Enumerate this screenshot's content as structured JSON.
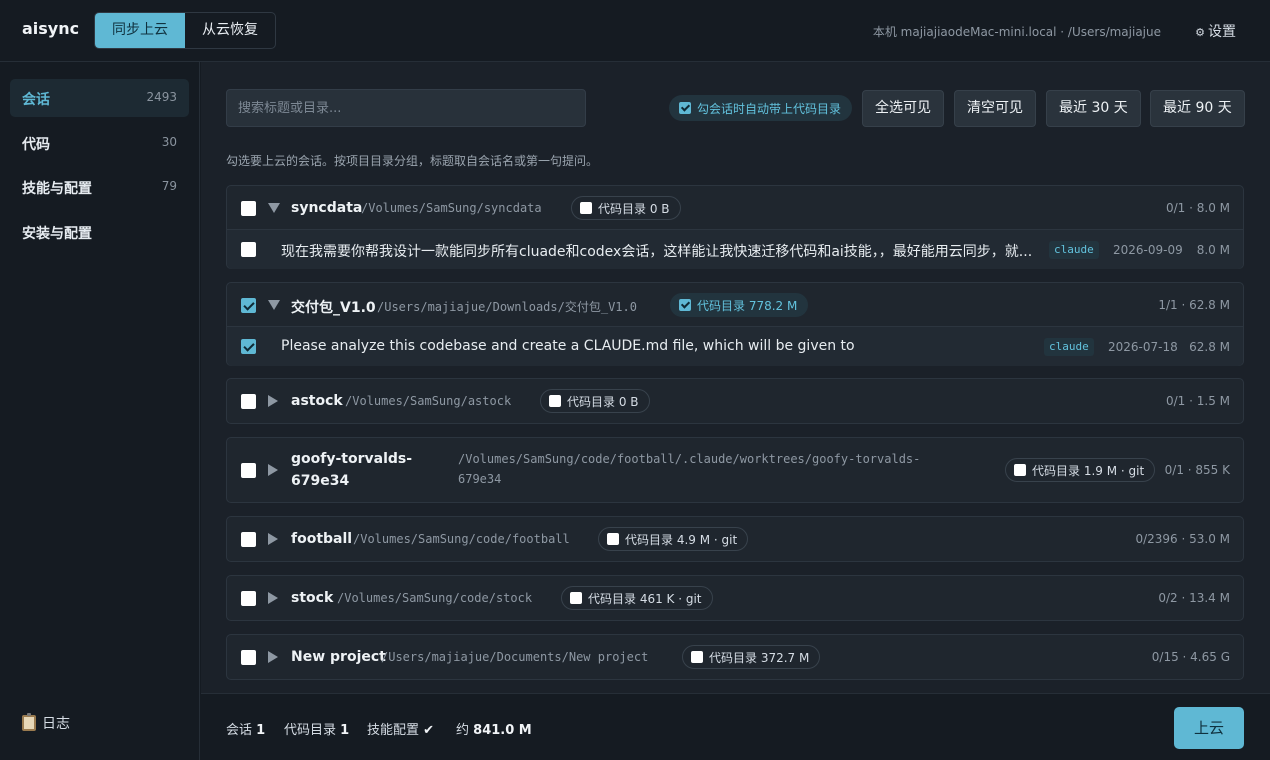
{
  "app": {
    "title": "aisync"
  },
  "header": {
    "modes": [
      {
        "label": "同步上云",
        "active": true
      },
      {
        "label": "从云恢复",
        "active": false
      }
    ],
    "host_info": "本机 majiajiaodeMac-mini.local · /Users/majiajue",
    "settings_label": "设置",
    "settings_icon": "gear-icon"
  },
  "sidebar": {
    "items": [
      {
        "label": "会话",
        "count": "2493",
        "active": true
      },
      {
        "label": "代码",
        "count": "30",
        "active": false
      },
      {
        "label": "技能与配置",
        "count": "79",
        "active": false
      },
      {
        "label": "安装与配置",
        "count": "",
        "active": false
      }
    ],
    "log_label": "日志",
    "log_icon": "clipboard-icon"
  },
  "toolbar": {
    "search_placeholder": "搜索标题或目录...",
    "auto_include_label": "勾会话时自动带上代码目录",
    "auto_include_checked": true,
    "select_visible": "全选可见",
    "clear_visible": "清空可见",
    "last_30": "最近 30 天",
    "last_90": "最近 90 天"
  },
  "hint": "勾选要上云的会话。按项目目录分组，标题取自会话名或第一句提问。",
  "groups": [
    {
      "name": "syncdata",
      "path": "/Volumes/SamSung/syncdata",
      "checked": false,
      "expanded": true,
      "code_label": "代码目录 0 B",
      "code_checked": false,
      "stat": "0/1 · 8.0 M",
      "sessions": [
        {
          "title": "现在我需要你帮我设计一款能同步所有cluade和codex会话，这样能让我快速迁移代码和ai技能，，最好能用云同步，就...",
          "tag": "claude",
          "date": "2026-09-09",
          "size": "8.0 M",
          "checked": false
        }
      ]
    },
    {
      "name": "交付包_V1.0",
      "path": "/Users/majiajue/Downloads/交付包_V1.0",
      "checked": true,
      "expanded": true,
      "code_label": "代码目录 778.2 M",
      "code_checked": true,
      "stat": "1/1 · 62.8 M",
      "sessions": [
        {
          "title": "Please analyze this codebase and create a CLAUDE.md file, which will be given to",
          "tag": "claude",
          "date": "2026-07-18",
          "size": "62.8 M",
          "checked": true
        }
      ]
    },
    {
      "name": "astock",
      "path": "/Volumes/SamSung/astock",
      "checked": false,
      "expanded": false,
      "code_label": "代码目录 0 B",
      "code_checked": false,
      "stat": "0/1 · 1.5 M"
    },
    {
      "name": "goofy-torvalds-679e34",
      "name_line1": "goofy-torvalds-",
      "name_line2": "679e34",
      "path": "/Volumes/SamSung/code/football/.claude/worktrees/goofy-torvalds-679e34",
      "path_line1": "/Volumes/SamSung/code/football/.claude/worktrees/goofy-torvalds-",
      "path_line2": "679e34",
      "checked": false,
      "expanded": false,
      "code_label": "代码目录 1.9 M · git",
      "code_checked": false,
      "stat": "0/1 · 855 K"
    },
    {
      "name": "football",
      "path": "/Volumes/SamSung/code/football",
      "checked": false,
      "expanded": false,
      "code_label": "代码目录 4.9 M · git",
      "code_checked": false,
      "stat": "0/2396 · 53.0 M"
    },
    {
      "name": "stock",
      "path": "/Volumes/SamSung/code/stock",
      "checked": false,
      "expanded": false,
      "code_label": "代码目录 461 K · git",
      "code_checked": false,
      "stat": "0/2 · 13.4 M"
    },
    {
      "name": "New project",
      "path": "/Users/majiajue/Documents/New project",
      "checked": false,
      "expanded": false,
      "code_label": "代码目录 372.7 M",
      "code_checked": false,
      "stat": "0/15 · 4.65 G"
    }
  ],
  "footer": {
    "sessions_label": "会话",
    "sessions_value": "1",
    "code_label": "代码目录",
    "code_value": "1",
    "skills_label": "技能配置",
    "skills_value": "✔",
    "total_label": "约",
    "total_value": "841.0 M",
    "upload_label": "上云"
  },
  "colors": {
    "accent": "#5fb8d4",
    "background": "#151b22",
    "panel": "#1b2129"
  }
}
